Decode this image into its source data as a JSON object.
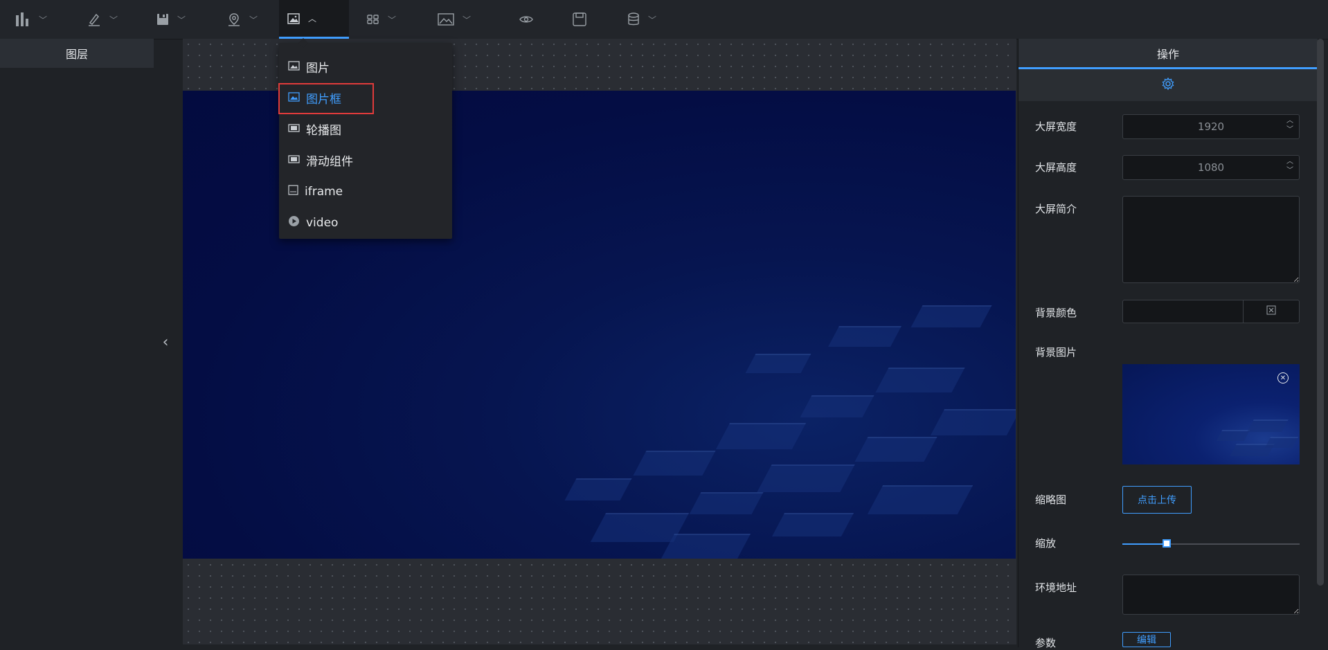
{
  "toolbar": {
    "items": [
      {
        "icon": "bar-chart-icon",
        "has_chevron": true
      },
      {
        "icon": "pen-icon",
        "has_chevron": true
      },
      {
        "icon": "save-icon",
        "has_chevron": true
      },
      {
        "icon": "map-pin-icon",
        "has_chevron": true
      },
      {
        "icon": "image-icon",
        "has_chevron": true,
        "active": true
      },
      {
        "icon": "grid-icon",
        "has_chevron": true
      },
      {
        "icon": "picture-icon",
        "has_chevron": true
      },
      {
        "icon": "eye-icon",
        "has_chevron": false
      },
      {
        "icon": "floppy-icon",
        "has_chevron": false
      },
      {
        "icon": "database-icon",
        "has_chevron": true
      }
    ]
  },
  "left_panel": {
    "title": "图层"
  },
  "dropdown": {
    "items": [
      {
        "label": "图片",
        "icon": "image-icon"
      },
      {
        "label": "图片框",
        "icon": "image-frame-icon",
        "selected": true
      },
      {
        "label": "轮播图",
        "icon": "carousel-icon"
      },
      {
        "label": "滑动组件",
        "icon": "slider-component-icon"
      },
      {
        "label": "iframe",
        "icon": "iframe-icon"
      },
      {
        "label": "video",
        "icon": "video-play-icon"
      }
    ]
  },
  "right_panel": {
    "tab_label": "操作",
    "width_label": "大屏宽度",
    "width_value": "1920",
    "height_label": "大屏高度",
    "height_value": "1080",
    "intro_label": "大屏简介",
    "bg_color_label": "背景颜色",
    "bg_image_label": "背景图片",
    "thumbnail_label": "缩略图",
    "upload_label": "点击上传",
    "zoom_label": "缩放",
    "zoom_level": 0.25,
    "env_label": "环境地址",
    "params_label": "参数",
    "edit_label": "编辑"
  },
  "colors": {
    "accent": "#409eff",
    "highlight": "#e03b3b"
  }
}
